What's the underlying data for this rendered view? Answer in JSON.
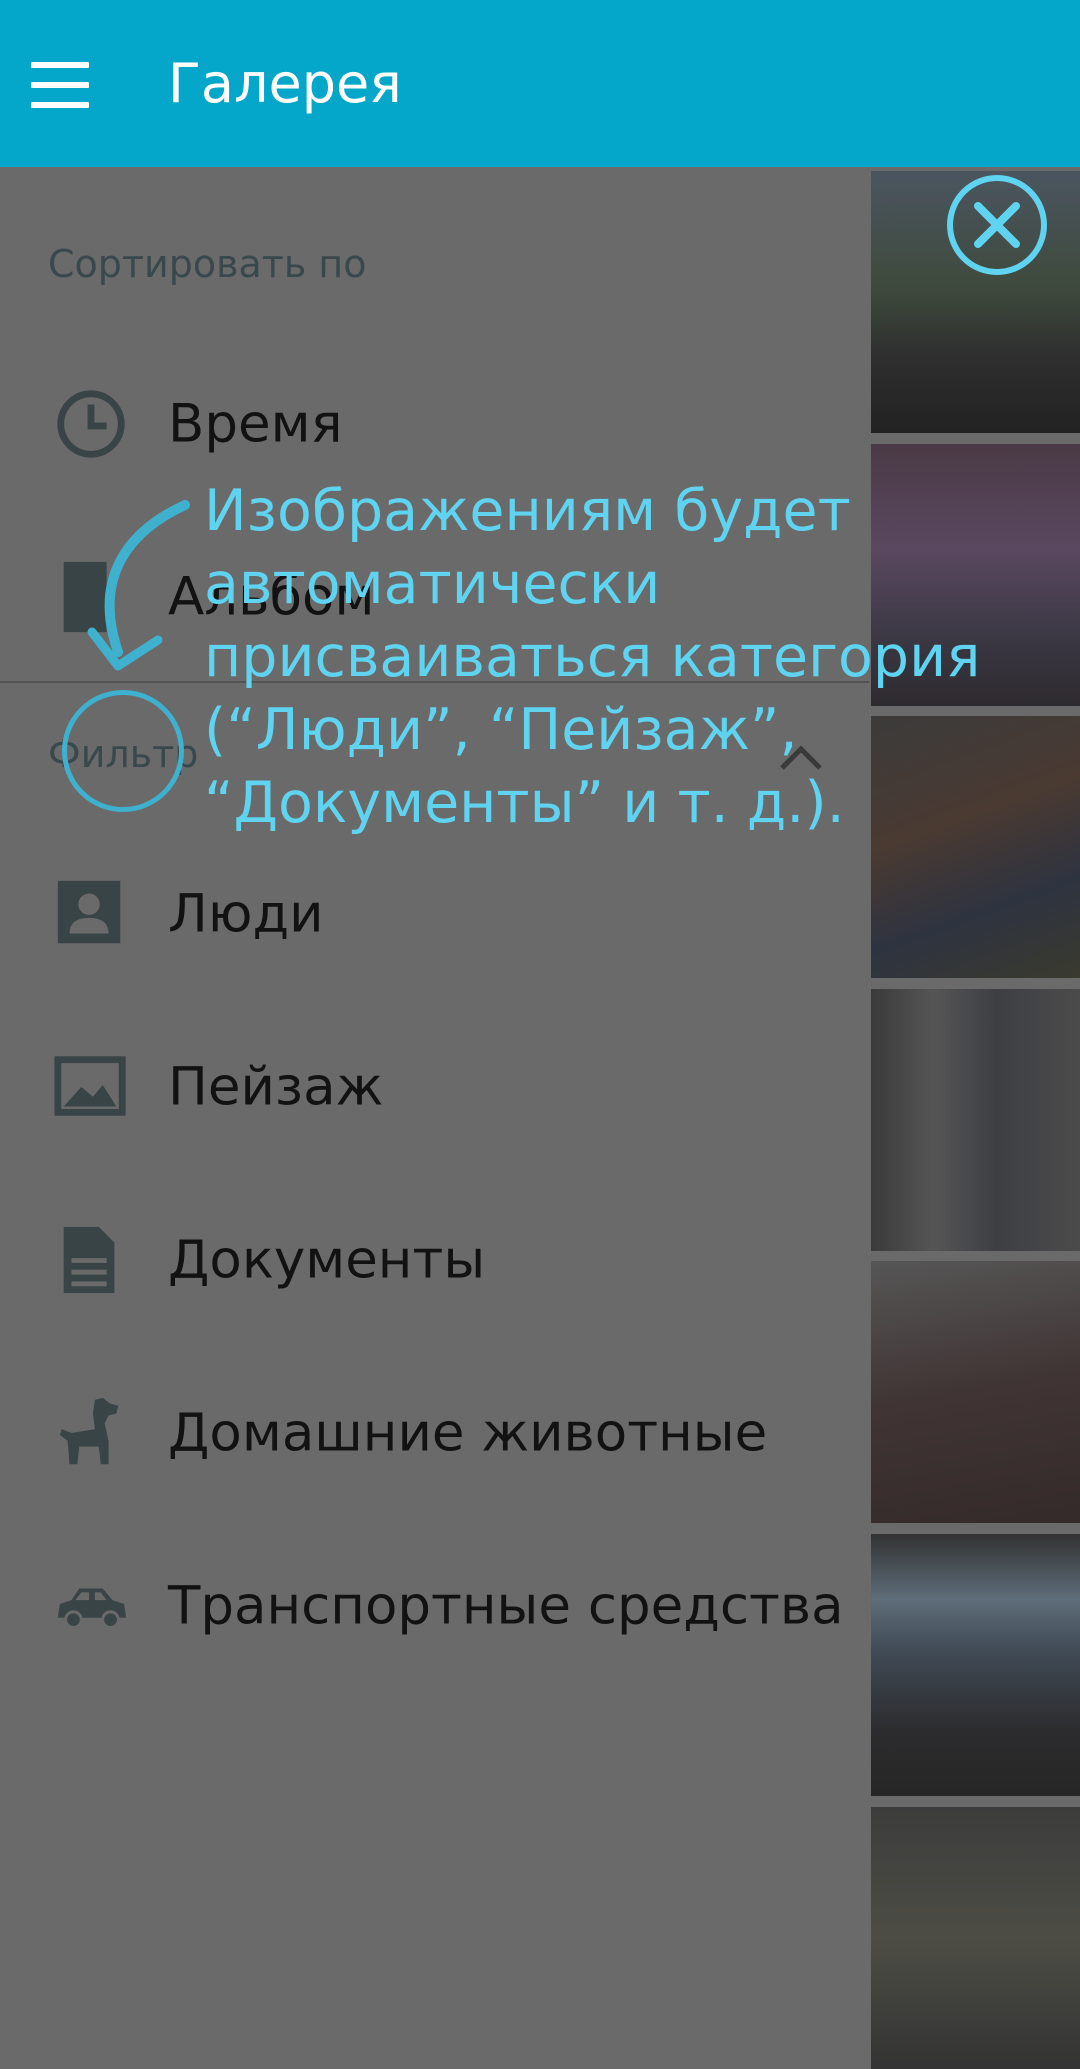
{
  "app": {
    "title": "Галерея"
  },
  "drawer": {
    "sort_header": "Сортировать по",
    "sort_items": [
      {
        "label": "Время",
        "icon": "clock-icon"
      },
      {
        "label": "Альбом",
        "icon": "album-icon"
      }
    ],
    "filter_header": "Фильтр",
    "filter_items": [
      {
        "label": "Люди",
        "icon": "person-icon"
      },
      {
        "label": "Пейзаж",
        "icon": "landscape-icon"
      },
      {
        "label": "Документы",
        "icon": "document-icon"
      },
      {
        "label": "Домашние животные",
        "icon": "dog-icon"
      },
      {
        "label": "Транспортные средства",
        "icon": "car-icon"
      }
    ]
  },
  "tutorial": {
    "lines": [
      "Изображениям будет",
      "автоматически",
      "присваиваться категория",
      "(“Люди”, “Пейзаж”,",
      "“Документы” и т. д.)."
    ]
  },
  "colors": {
    "appbar": "#04a7c9",
    "tip_text": "#5fd3f0",
    "dim_background": "#6a6a6a"
  }
}
